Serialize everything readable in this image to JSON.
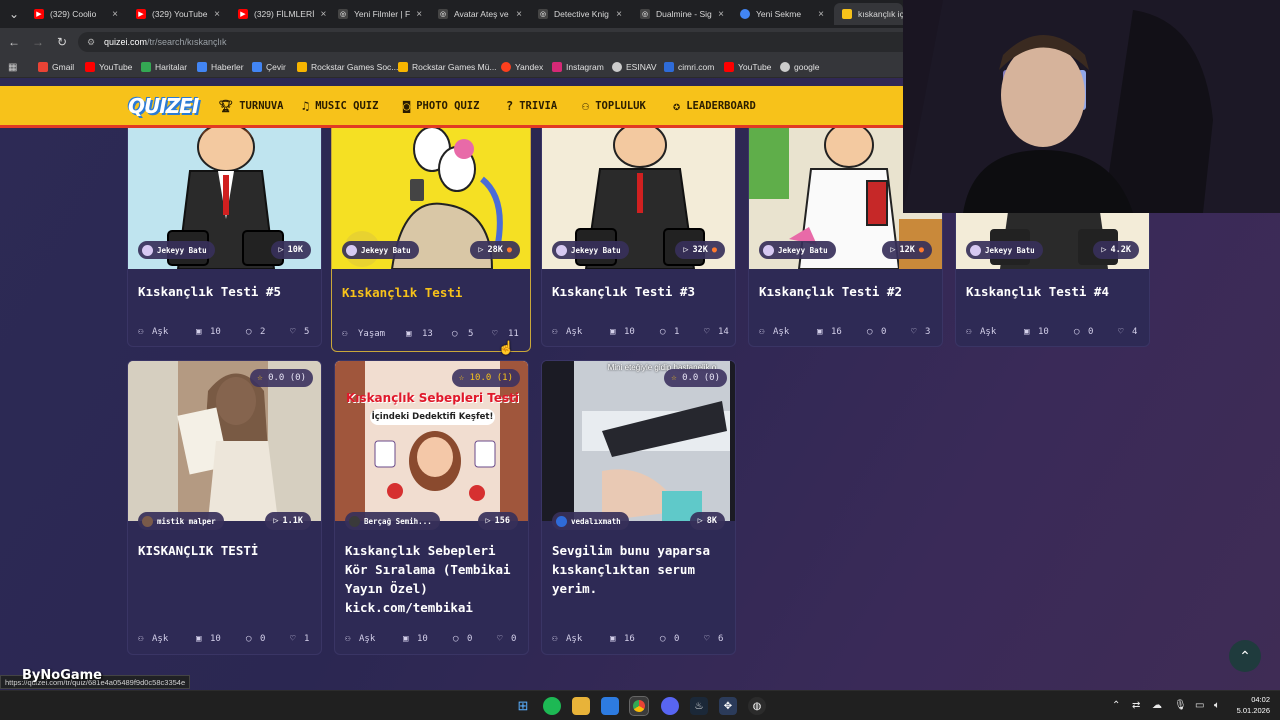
{
  "tabs": [
    {
      "label": "(329) Coolio",
      "icon": "youtube-icon",
      "active": false
    },
    {
      "label": "(329) YouTube",
      "icon": "youtube-icon",
      "active": false
    },
    {
      "label": "(329) FİLMLERİ",
      "icon": "youtube-icon",
      "active": false
    },
    {
      "label": "Yeni Filmler | F",
      "icon": "globe-icon",
      "active": false
    },
    {
      "label": "Avatar Ateş ve",
      "icon": "globe-icon",
      "active": false
    },
    {
      "label": "Detective Knig",
      "icon": "globe-icon",
      "active": false
    },
    {
      "label": "Dualmine - Sig",
      "icon": "globe-icon",
      "active": false
    },
    {
      "label": "Yeni Sekme",
      "icon": "chrome-icon",
      "active": false
    },
    {
      "label": "kıskançlık için",
      "icon": "quizei-icon",
      "active": true
    }
  ],
  "omnibox": {
    "host": "quizei.com",
    "path": "/tr/search/kıskançlık"
  },
  "bookmarks": [
    {
      "label": "Gmail",
      "color": "#ea4335"
    },
    {
      "label": "YouTube",
      "color": "#ff0000"
    },
    {
      "label": "Haritalar",
      "color": "#34a853"
    },
    {
      "label": "Haberler",
      "color": "#4285f4"
    },
    {
      "label": "Çevir",
      "color": "#4285f4"
    },
    {
      "label": "Rockstar Games Soc...",
      "color": "#f7b500"
    },
    {
      "label": "Rockstar Games Mü...",
      "color": "#f7b500"
    },
    {
      "label": "Yandex",
      "color": "#fc3f1d"
    },
    {
      "label": "Instagram",
      "color": "#d62976"
    },
    {
      "label": "ESINAV",
      "color": "#cccccc"
    },
    {
      "label": "cimri.com",
      "color": "#2e6bd8"
    },
    {
      "label": "YouTube",
      "color": "#ff0000"
    },
    {
      "label": "google",
      "color": "#cccccc"
    }
  ],
  "site": {
    "logo": "QUIZEI",
    "nav": [
      {
        "label": "TURNUVA",
        "icon": "trophy-icon"
      },
      {
        "label": "MUSIC QUIZ",
        "icon": "music-icon"
      },
      {
        "label": "PHOTO QUIZ",
        "icon": "camera-icon"
      },
      {
        "label": "TRIVIA",
        "icon": "question-icon"
      },
      {
        "label": "TOPLULUK",
        "icon": "users-icon"
      },
      {
        "label": "LEADERBOARD",
        "icon": "badge-icon"
      }
    ]
  },
  "cards_row1": [
    {
      "author": "Jekeyy Batu",
      "plays": "10K",
      "title": "Kıskançlık Testi #5",
      "category": "Aşk",
      "questions": "10",
      "comments": "2",
      "likes": "5",
      "hot": false
    },
    {
      "author": "Jekeyy Batu",
      "plays": "28K",
      "title": "Kıskançlık Testi",
      "category": "Yaşam",
      "questions": "13",
      "comments": "5",
      "likes": "11",
      "hot": true
    },
    {
      "author": "Jekeyy Batu",
      "plays": "32K",
      "title": "Kıskançlık Testi #3",
      "category": "Aşk",
      "questions": "10",
      "comments": "1",
      "likes": "14",
      "hot": true
    },
    {
      "author": "Jekeyy Batu",
      "plays": "12K",
      "title": "Kıskançlık Testi #2",
      "category": "Aşk",
      "questions": "16",
      "comments": "0",
      "likes": "3",
      "hot": true
    },
    {
      "author": "Jekeyy Batu",
      "plays": "4.2K",
      "title": "Kıskançlık Testi #4",
      "category": "Aşk",
      "questions": "10",
      "comments": "0",
      "likes": "4",
      "hot": false
    }
  ],
  "cards_row2": [
    {
      "rating": "0.0 (0)",
      "author": "mistik malper",
      "plays": "1.1K",
      "title": "KISKANÇLIK TESTİ",
      "category": "Aşk",
      "questions": "10",
      "comments": "0",
      "likes": "1"
    },
    {
      "rating": "10.0 (1)",
      "author": "Berçağ Semih...",
      "plays": "156",
      "title": "Kıskançlık Sebepleri Kör Sıralama (Tembikai Yayın Özel) kick.com/tembikai",
      "category": "Aşk",
      "questions": "10",
      "comments": "0",
      "likes": "0",
      "thumb_title": "Kıskançlık Sebepleri Testi",
      "thumb_subtitle": "İçindeki Dedektifi Keşfet!"
    },
    {
      "rating": "0.0 (0)",
      "author": "vedalıxmath",
      "plays": "8K",
      "title": "Sevgilim bunu yaparsa kıskançlıktan serum yerim.",
      "category": "Aşk",
      "questions": "16",
      "comments": "0",
      "likes": "6",
      "thumb_caption": "Mini eteğiyle gidip hastanelik o"
    }
  ],
  "status_link": "https://quizei.com/tr/quiz/681e4a05489f9d0c58c3354e",
  "watermark": "ByNoGame",
  "clock": {
    "time": "04:02",
    "date": "5.01.2026"
  },
  "colors": {
    "header": "#f7c21a",
    "header_border": "#e23a23",
    "card_bg": "#2e2a55",
    "accent": "#f7c21a"
  }
}
